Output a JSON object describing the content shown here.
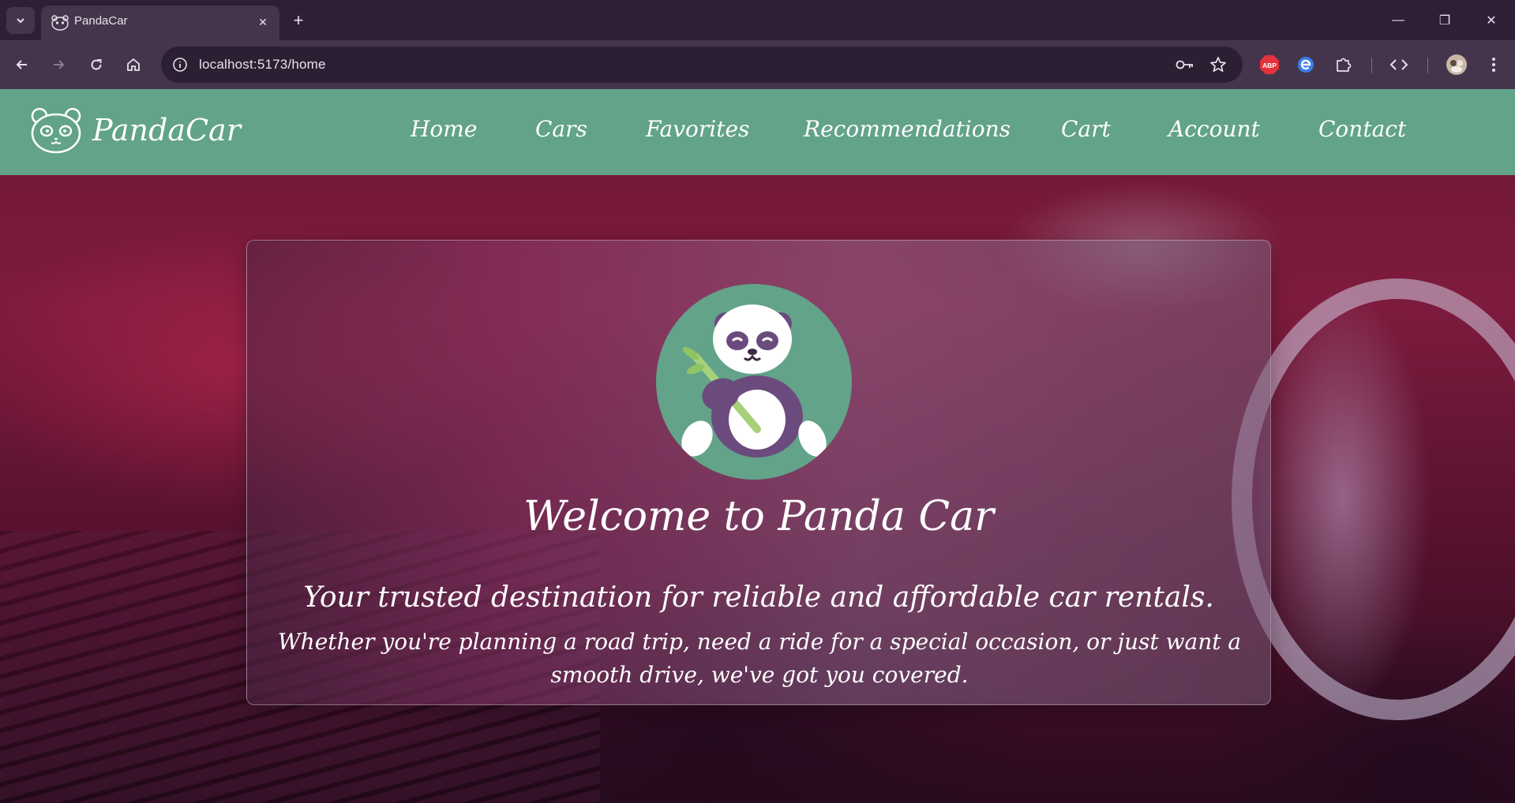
{
  "browser": {
    "tab_title": "PandaCar",
    "url": "localhost:5173/home",
    "window_controls": {
      "minimize": "—",
      "restore": "❐",
      "close": "✕"
    },
    "icons": [
      "tab-list-icon",
      "panda-favicon",
      "close-tab-icon",
      "new-tab-icon",
      "back-icon",
      "forward-icon",
      "reload-icon",
      "home-icon",
      "site-info-icon",
      "password-key-icon",
      "bookmark-star-icon",
      "adblock-icon",
      "extension-e-icon",
      "puzzle-extensions-icon",
      "devtools-icon",
      "profile-avatar-icon",
      "kebab-menu-icon"
    ],
    "adblock_label": "ABP"
  },
  "navbar": {
    "brand": "PandaCar",
    "links": [
      "Home",
      "Cars",
      "Favorites",
      "Recommendations",
      "Cart",
      "Account",
      "Contact"
    ],
    "color": "#62a38a"
  },
  "hero": {
    "title": "Welcome to Panda Car",
    "tagline": "Your trusted destination for reliable and affordable car rentals.",
    "description": "Whether you're planning a road trip, need a ride for a special occasion, or just want a smooth drive, we've got you covered."
  }
}
